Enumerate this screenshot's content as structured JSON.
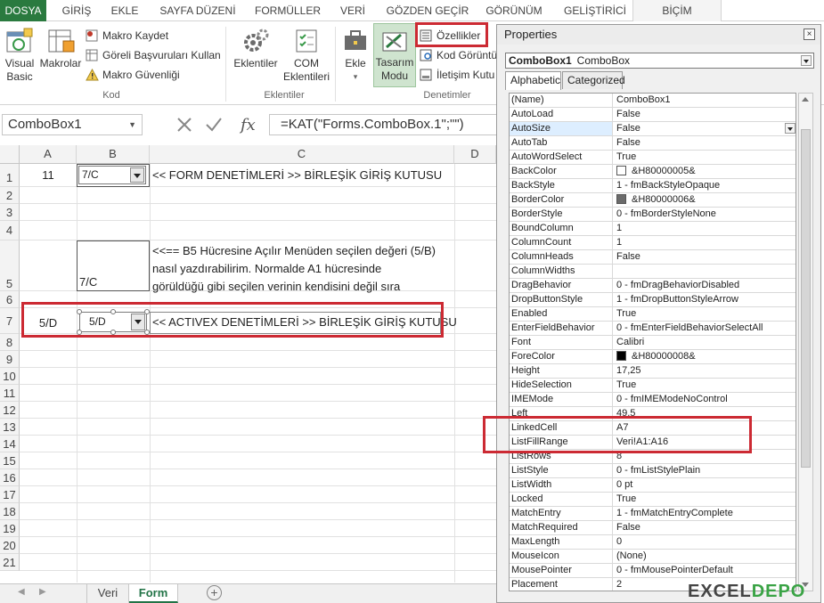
{
  "ribbon_tabs": [
    "DOSYA",
    "GİRİŞ",
    "EKLE",
    "SAYFA DÜZENİ",
    "FORMÜLLER",
    "VERİ",
    "GÖZDEN GEÇİR",
    "GÖRÜNÜM",
    "GELİŞTİRİCİ",
    "BİÇİM"
  ],
  "ribbon": {
    "visual_basic": "Visual Basic",
    "macros": "Makrolar",
    "record_macro": "Makro Kaydet",
    "relative_refs": "Göreli Başvuruları Kullan",
    "macro_security": "Makro Güvenliği",
    "group_code": "Kod",
    "addins": "Eklentiler",
    "com_addins": "COM Eklentileri",
    "group_addins": "Eklentiler",
    "insert": "Ekle",
    "design_mode": "Tasarım Modu",
    "properties": "Özellikler",
    "view_code": "Kod Görüntü",
    "run_dialog": "İletişim Kutu",
    "group_controls": "Denetimler"
  },
  "formula_bar": {
    "name_box": "ComboBox1",
    "formula": "=KAT(\"Forms.ComboBox.1\";\"\")"
  },
  "columns": [
    "A",
    "B",
    "C",
    "D"
  ],
  "rows": [
    "1",
    "2",
    "3",
    "4",
    "5",
    "6",
    "7",
    "8",
    "9",
    "10",
    "11",
    "12",
    "13",
    "14",
    "15",
    "16",
    "17",
    "18",
    "19",
    "20",
    "21"
  ],
  "cells": {
    "A1": "11",
    "B1_combo": "7/C",
    "C1": "<< FORM DENETİMLERİ >> BİRLEŞİK GİRİŞ KUTUSU",
    "B5": "7/C",
    "C5_line1": "<<== B5 Hücresine Açılır Menüden seçilen değeri (5/B)",
    "C5_line2": "nasıl yazdırabilirim. Normalde A1 hücresinde",
    "C5_line3": "görüldüğü gibi seçilen verinin kendisini değil sıra",
    "A7": "5/D",
    "B7_combo": "5/D",
    "C7": "<< ACTIVEX DENETİMLERİ >> BİRLEŞİK GİRİŞ KUTUSU"
  },
  "sheet_tabs": [
    "Veri",
    "Form"
  ],
  "active_sheet": "Form",
  "properties_window": {
    "title": "Properties",
    "object_name": "ComboBox1",
    "object_type": "ComboBox",
    "tab_alphabetic": "Alphabetic",
    "tab_categorized": "Categorized",
    "rows": [
      {
        "k": "(Name)",
        "v": "ComboBox1"
      },
      {
        "k": "AutoLoad",
        "v": "False"
      },
      {
        "k": "AutoSize",
        "v": "False"
      },
      {
        "k": "AutoTab",
        "v": "False"
      },
      {
        "k": "AutoWordSelect",
        "v": "True"
      },
      {
        "k": "BackColor",
        "v": "&H80000005&"
      },
      {
        "k": "BackStyle",
        "v": "1 - fmBackStyleOpaque"
      },
      {
        "k": "BorderColor",
        "v": "&H80000006&"
      },
      {
        "k": "BorderStyle",
        "v": "0 - fmBorderStyleNone"
      },
      {
        "k": "BoundColumn",
        "v": "1"
      },
      {
        "k": "ColumnCount",
        "v": "1"
      },
      {
        "k": "ColumnHeads",
        "v": "False"
      },
      {
        "k": "ColumnWidths",
        "v": ""
      },
      {
        "k": "DragBehavior",
        "v": "0 - fmDragBehaviorDisabled"
      },
      {
        "k": "DropButtonStyle",
        "v": "1 - fmDropButtonStyleArrow"
      },
      {
        "k": "Enabled",
        "v": "True"
      },
      {
        "k": "EnterFieldBehavior",
        "v": "0 - fmEnterFieldBehaviorSelectAll"
      },
      {
        "k": "Font",
        "v": "Calibri"
      },
      {
        "k": "ForeColor",
        "v": "&H80000008&"
      },
      {
        "k": "Height",
        "v": "17,25"
      },
      {
        "k": "HideSelection",
        "v": "True"
      },
      {
        "k": "IMEMode",
        "v": "0 - fmIMEModeNoControl"
      },
      {
        "k": "Left",
        "v": "49,5"
      },
      {
        "k": "LinkedCell",
        "v": "A7"
      },
      {
        "k": "ListFillRange",
        "v": "Veri!A1:A16"
      },
      {
        "k": "ListRows",
        "v": "8"
      },
      {
        "k": "ListStyle",
        "v": "0 - fmListStylePlain"
      },
      {
        "k": "ListWidth",
        "v": "0 pt"
      },
      {
        "k": "Locked",
        "v": "True"
      },
      {
        "k": "MatchEntry",
        "v": "1 - fmMatchEntryComplete"
      },
      {
        "k": "MatchRequired",
        "v": "False"
      },
      {
        "k": "MaxLength",
        "v": "0"
      },
      {
        "k": "MouseIcon",
        "v": "(None)"
      },
      {
        "k": "MousePointer",
        "v": "0 - fmMousePointerDefault"
      },
      {
        "k": "Placement",
        "v": "2"
      }
    ]
  },
  "logo": {
    "part1": "EXCEL",
    "part2": "DEPO"
  },
  "colors": {
    "accent_red": "#cc2a33",
    "excel_green": "#217346"
  }
}
